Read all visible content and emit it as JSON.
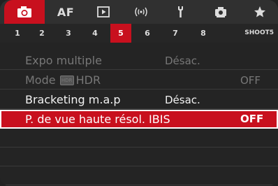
{
  "tabs": [
    {
      "id": "shoot",
      "icon": "camera-icon",
      "active": true
    },
    {
      "id": "af",
      "label": "AF"
    },
    {
      "id": "playback",
      "icon": "playback-icon"
    },
    {
      "id": "network",
      "icon": "wireless-icon"
    },
    {
      "id": "setup",
      "icon": "wrench-icon"
    },
    {
      "id": "custom",
      "icon": "custom-functions-icon"
    },
    {
      "id": "mymenu",
      "icon": "star-icon"
    }
  ],
  "pages": [
    "1",
    "2",
    "3",
    "4",
    "5",
    "6",
    "7",
    "8"
  ],
  "active_page": "5",
  "page_name": "SHOOT5",
  "menu": [
    {
      "label": "Expo multiple",
      "value": "Désac.",
      "enabled": false
    },
    {
      "label_prefix": "Mode",
      "badge": "HDR",
      "label_suffix": "HDR",
      "value": "OFF",
      "enabled": false
    },
    {
      "label": "Bracketing m.a.p",
      "value": "Désac.",
      "enabled": true
    },
    {
      "label": "P. de vue haute résol. IBIS",
      "value": "OFF",
      "enabled": true,
      "selected": true
    }
  ],
  "colors": {
    "accent": "#c8101e",
    "background": "#242424"
  }
}
